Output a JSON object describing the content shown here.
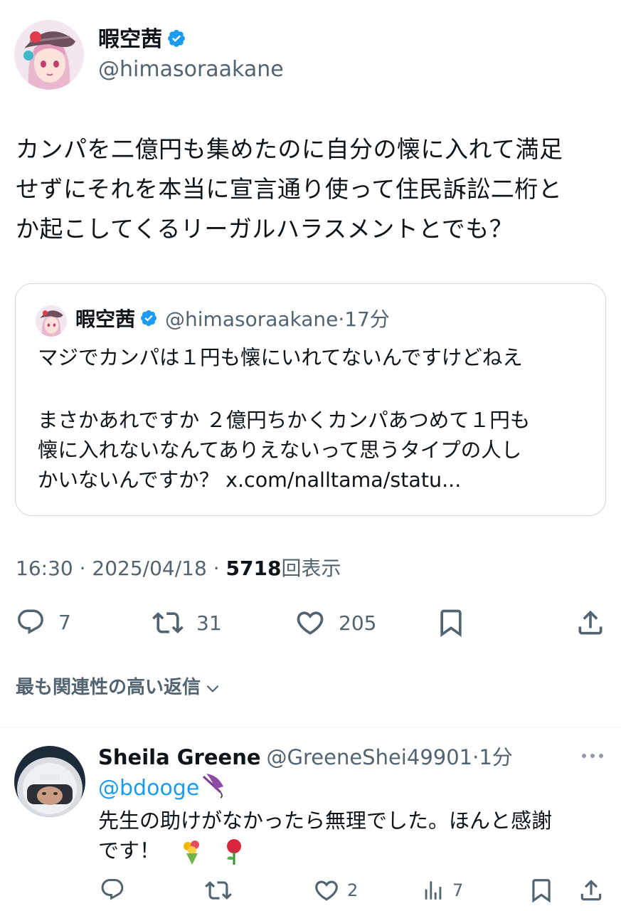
{
  "author": {
    "name": "暇空茜",
    "handle": "@himasoraakane"
  },
  "tweet": {
    "lines": [
      "カンパを二億円も集めたのに自分の懐に入れて満足",
      "せずにそれを本当に宣言通り使って住民訴訟二桁と",
      "か起こしてくるリーガルハラスメントとでも？"
    ]
  },
  "quote": {
    "name": "暇空茜",
    "handle": "@himasoraakane",
    "separator": "·",
    "time": "17分",
    "lines": [
      "マジでカンパは１円も懐にいれてないんですけどねえ",
      "まさかあれですか ２億円ちかくカンパあつめて１円も",
      "懐に入れないなんてありえないって思うタイプの人し",
      "かいないんですか？ x.com/nalltama/statu..."
    ]
  },
  "meta": {
    "time": "16:30",
    "date": "2025/04/18",
    "views": "5718",
    "views_label": "回表示",
    "separator": " · "
  },
  "actions": {
    "replies": "7",
    "retweets": "31",
    "likes": "205"
  },
  "relevant_replies_label": "最も関連性の高い返信",
  "reply": {
    "name": "Sheila Greene",
    "handle": "@GreeneShei49901",
    "separator": "·",
    "time": "1分",
    "mention": "@bdooge",
    "lines": [
      " 先生の助けがなかったら無理でした。ほんと感謝",
      "です！ "
    ],
    "likes": "2",
    "views": "7"
  },
  "colors": {
    "accent": "#1d9bf0",
    "text": "#0f1419",
    "secondary": "#536471",
    "border": "#cfd9de"
  },
  "icons": [
    "verified-badge-icon",
    "reply-icon",
    "retweet-icon",
    "like-icon",
    "bookmark-icon",
    "share-icon",
    "chevron-down-icon",
    "more-icon",
    "views-icon",
    "umbrella-emoji",
    "bouquet-emoji",
    "rose-emoji"
  ]
}
